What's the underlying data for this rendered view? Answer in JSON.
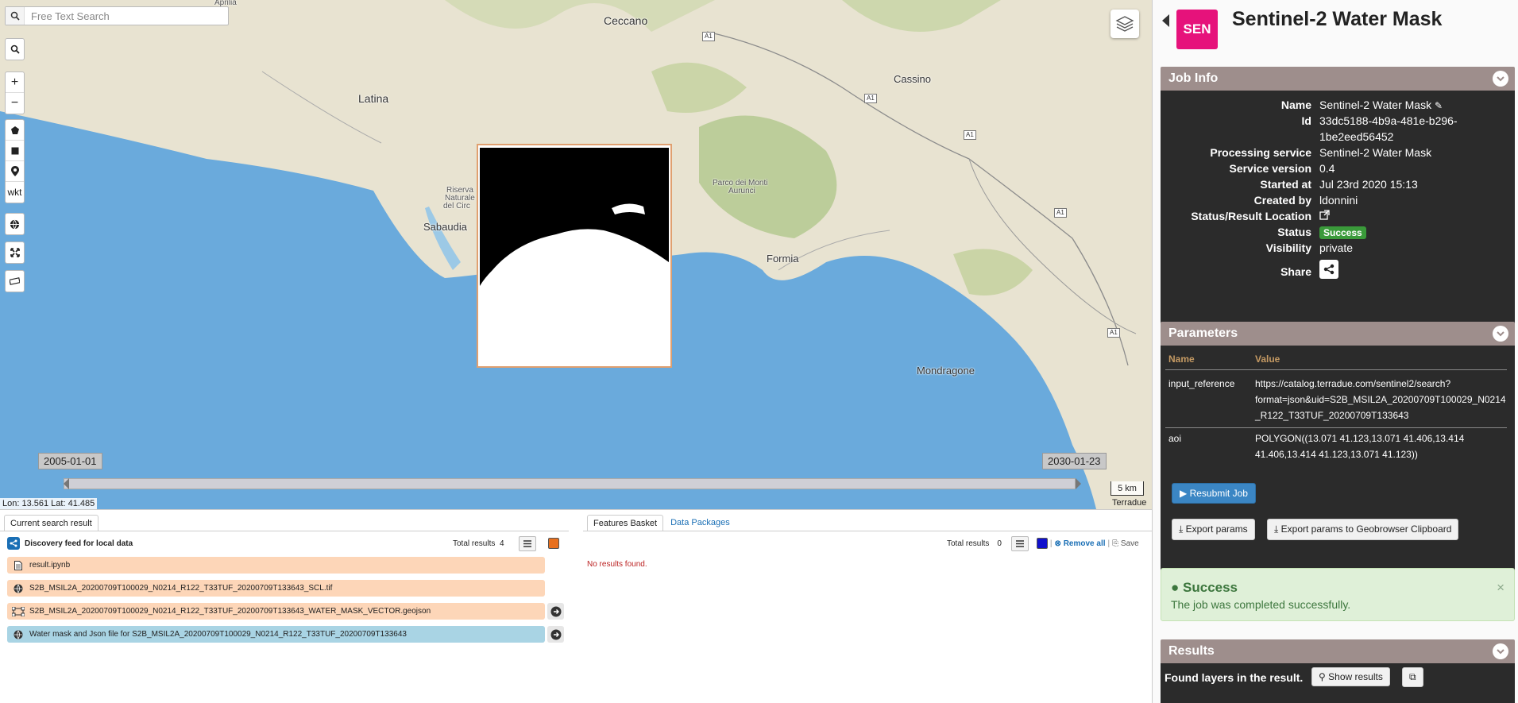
{
  "map": {
    "search_placeholder": "Free Text Search",
    "places": {
      "aprilia": "Aprilia",
      "ceccano": "Ceccano",
      "latina": "Latina",
      "cassino": "Cassino",
      "sabaudia": "Sabaudia",
      "riserva_1": "Riserva",
      "riserva_2": "Naturale",
      "riserva_3": "del Circ",
      "parco_1": "Parco dei Monti",
      "parco_2": "Aurunci",
      "formia": "Formia",
      "mondragone": "Mondragone"
    },
    "roads": {
      "a1_1": "A1",
      "a1_2": "A1",
      "a1_3": "A1",
      "a1_4": "A1",
      "a1_5": "A1"
    },
    "tools": {
      "zoom_in": "+",
      "zoom_out": "−",
      "wkt": "wkt"
    },
    "time_start": "2005-01-01",
    "time_end": "2030-01-23",
    "scale": "5 km",
    "attribution": "Terradue",
    "coords": "Lon: 13.561 Lat: 41.485"
  },
  "left_panel": {
    "tab": "Current search result",
    "feed_title": "Discovery feed for local data",
    "total_label": "Total results",
    "total_value": "4",
    "swatch_color": "#e8701e",
    "items": [
      {
        "icon": "file-icon",
        "label": "result.ipynb",
        "color": "#fdd6b8"
      },
      {
        "icon": "globe-icon",
        "label": "S2B_MSIL2A_20200709T100029_N0214_R122_T33TUF_20200709T133643_SCL.tif",
        "color": "#fdd6b8"
      },
      {
        "icon": "vector-icon",
        "label": "S2B_MSIL2A_20200709T100029_N0214_R122_T33TUF_20200709T133643_WATER_MASK_VECTOR.geojson",
        "color": "#fdd6b8"
      },
      {
        "icon": "globe-icon",
        "label": "Water mask and Json file for S2B_MSIL2A_20200709T100029_N0214_R122_T33TUF_20200709T133643",
        "color": "#a9d4e4"
      }
    ]
  },
  "right_panel": {
    "tab_basket": "Features Basket",
    "tab_packages": "Data Packages",
    "total_label": "Total results",
    "total_value": "0",
    "swatch_color": "#1111cc",
    "remove_all": "Remove all",
    "separator": "|",
    "save": "Save",
    "no_results": "No results found."
  },
  "side": {
    "badge": "SEN",
    "title": "Sentinel-2 Water Mask",
    "job_info": {
      "header": "Job Info",
      "rows": [
        {
          "key": "Name",
          "value": "Sentinel-2 Water Mask"
        },
        {
          "key": "Id",
          "value": "33dc5188-4b9a-481e-b296-"
        },
        {
          "key": "",
          "value": "1be2eed56452"
        },
        {
          "key": "Processing service",
          "value": "Sentinel-2 Water Mask"
        },
        {
          "key": "Service version",
          "value": "0.4"
        },
        {
          "key": "Started at",
          "value": "Jul 23rd 2020 15:13"
        },
        {
          "key": "Created by",
          "value": "ldonnini"
        },
        {
          "key": "Status/Result Location",
          "value": ""
        },
        {
          "key": "Status",
          "value": "Success"
        },
        {
          "key": "Visibility",
          "value": "private"
        },
        {
          "key": "Share",
          "value": ""
        }
      ]
    },
    "parameters": {
      "header": "Parameters",
      "col_name": "Name",
      "col_value": "Value",
      "rows": [
        {
          "name": "input_reference",
          "v1": "https://catalog.terradue.com/sentinel2/search?",
          "v2": "format=json&uid=S2B_MSIL2A_20200709T100029_N0214",
          "v3": "_R122_T33TUF_20200709T133643"
        },
        {
          "name": "aoi",
          "v1": "POLYGON((13.071 41.123,13.071 41.406,13.414",
          "v2": "41.406,13.414 41.123,13.071 41.123))",
          "v3": ""
        }
      ]
    },
    "resubmit": "Resubmit Job",
    "export_params": "Export params",
    "export_clipboard": "Export params to Geobrowser Clipboard",
    "alert_title": "Success",
    "alert_msg": "The job was completed successfully.",
    "alert_close": "×",
    "results": {
      "header": "Results",
      "found": "Found layers in the result.",
      "show": "Show results"
    }
  }
}
